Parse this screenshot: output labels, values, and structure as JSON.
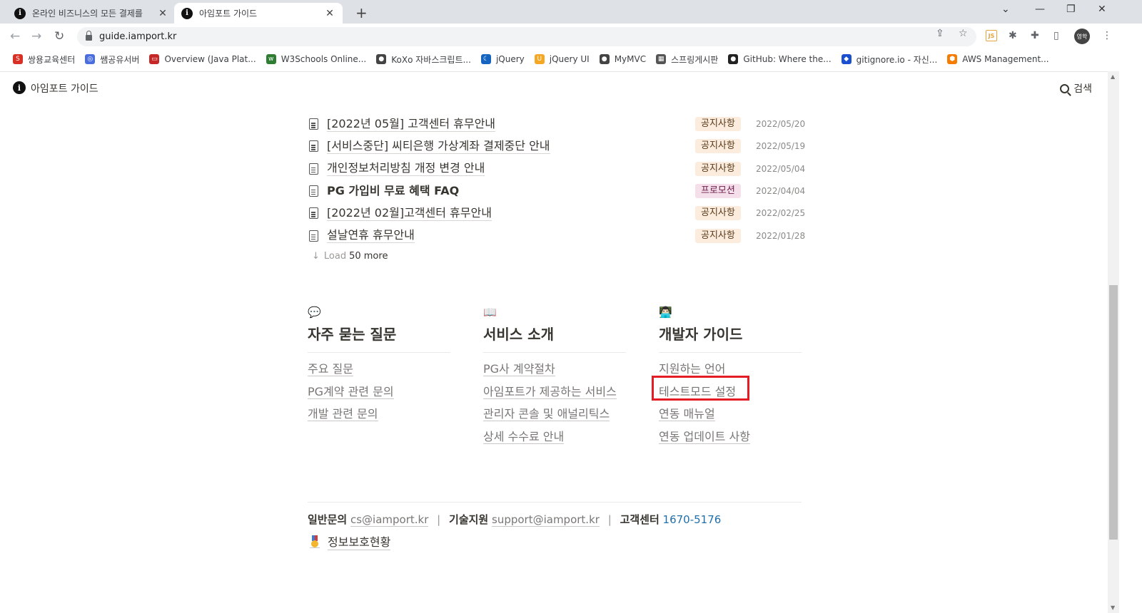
{
  "browser": {
    "tabs": [
      {
        "title": "온라인 비즈니스의 모든 결제를",
        "active": false
      },
      {
        "title": "아임포트 가이드",
        "active": true
      }
    ],
    "url": "guide.iamport.kr",
    "profile_label": "영학",
    "ext_js_label": "JS",
    "bookmarks": [
      {
        "label": "쌍용교육센터",
        "color": "#d93025",
        "glyph": "S"
      },
      {
        "label": "쌤공유서버",
        "color": "#4a6ee0",
        "glyph": "◎"
      },
      {
        "label": "Overview (Java Plat...",
        "color": "#c62828",
        "glyph": "▭"
      },
      {
        "label": "W3Schools Online...",
        "color": "#2e7d32",
        "glyph": "w"
      },
      {
        "label": "KoXo 자바스크립트...",
        "color": "#444444",
        "glyph": "●"
      },
      {
        "label": "jQuery",
        "color": "#1565c0",
        "glyph": "☾"
      },
      {
        "label": "jQuery UI",
        "color": "#f5a623",
        "glyph": "U"
      },
      {
        "label": "MyMVC",
        "color": "#444444",
        "glyph": "●"
      },
      {
        "label": "스프링게시판",
        "color": "#555555",
        "glyph": "▦"
      },
      {
        "label": "GitHub: Where the...",
        "color": "#222222",
        "glyph": "●"
      },
      {
        "label": "gitignore.io - 자신...",
        "color": "#1a4fd0",
        "glyph": "◆"
      },
      {
        "label": "AWS Management...",
        "color": "#f57c00",
        "glyph": "⬢"
      }
    ]
  },
  "header": {
    "site_name": "아임포트 가이드",
    "search_label": "검색"
  },
  "notices": [
    {
      "title": "[2022년 05월] 고객센터 휴무안내",
      "tag": "공지사항",
      "tag_type": "notice",
      "date": "2022/05/20",
      "bold": false
    },
    {
      "title": "[서비스중단] 씨티은행 가상계좌 결제중단 안내",
      "tag": "공지사항",
      "tag_type": "notice",
      "date": "2022/05/19",
      "bold": false
    },
    {
      "title": "개인정보처리방침 개정 변경 안내",
      "tag": "공지사항",
      "tag_type": "notice",
      "date": "2022/05/04",
      "bold": false
    },
    {
      "title": "PG 가입비 무료 혜택 FAQ",
      "tag": "프로모션",
      "tag_type": "promo",
      "date": "2022/04/04",
      "bold": true
    },
    {
      "title": "[2022년 02월]고객센터 휴무안내",
      "tag": "공지사항",
      "tag_type": "notice",
      "date": "2022/02/25",
      "bold": false
    },
    {
      "title": "설날연휴 휴무안내",
      "tag": "공지사항",
      "tag_type": "notice",
      "date": "2022/01/28",
      "bold": false
    }
  ],
  "load_more": {
    "prefix": "Load",
    "count": "50 more"
  },
  "columns": [
    {
      "emoji": "💬",
      "title": "자주 묻는 질문",
      "links": [
        "주요 질문",
        "PG계약 관련 문의",
        "개발 관련 문의"
      ]
    },
    {
      "emoji": "📖",
      "title": "서비스 소개",
      "links": [
        "PG사 계약절차",
        "아임포트가 제공하는 서비스",
        "관리자 콘솔 및 애널리틱스",
        "상세 수수료 안내"
      ]
    },
    {
      "emoji": "👨🏻‍💻",
      "title": "개발자 가이드",
      "links": [
        "지원하는 언어",
        "테스트모드 설정",
        "연동 매뉴얼",
        "연동 업데이트 사항"
      ]
    }
  ],
  "footer": {
    "general_label": "일반문의",
    "general_email": "cs@iamport.kr",
    "tech_label": "기술지원",
    "tech_email": "support@iamport.kr",
    "cs_label": "고객센터",
    "cs_phone": "1670-5176",
    "separator": "|",
    "privacy_label": "정보보호현황"
  }
}
